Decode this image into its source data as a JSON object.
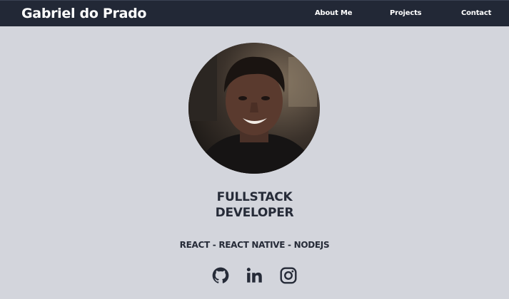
{
  "nav": {
    "brand": "Gabriel do Prado",
    "links": [
      "About Me",
      "Projects",
      "Contact"
    ]
  },
  "profile": {
    "headline_line1": "FULLSTACK",
    "headline_line2": "DEVELOPER",
    "stack": "REACT - REACT NATIVE - NODEJS"
  },
  "socials": {
    "icons": [
      "github-icon",
      "linkedin-icon",
      "instagram-icon"
    ]
  },
  "colors": {
    "navbar": "#222836",
    "background": "#d3d5dc",
    "text": "#262b38"
  }
}
